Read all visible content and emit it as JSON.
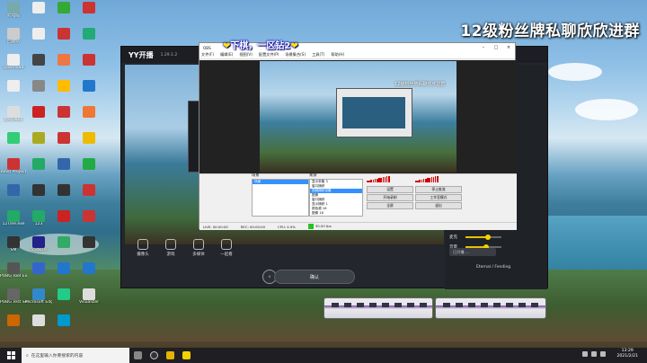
{
  "banner": {
    "text": "12级粉丝牌私聊欣欣进群"
  },
  "desktop": {
    "col1": [
      "此电脑",
      "回收站",
      "Download",
      "",
      "qyiqiweb",
      "",
      "Revit Project",
      "",
      "12Tree.exe",
      "SM",
      "PUBG Tool Experiment",
      "PUBG Test Server",
      "",
      "Microsoft Fortune",
      "",
      "飞"
    ],
    "col2": [
      "",
      "",
      "",
      "",
      "",
      "ESkin",
      "",
      "",
      "",
      "",
      "123",
      "554879",
      "",
      "Microsoft Edge",
      "",
      "Steam"
    ],
    "col3": [
      "",
      "",
      "",
      "",
      "",
      "",
      "",
      "",
      "",
      "",
      "",
      "",
      "",
      "VSCode",
      "QQ",
      "YY"
    ],
    "col4": [
      "",
      "",
      "",
      "",
      "",
      "",
      "",
      "",
      "",
      "",
      "",
      "",
      "",
      "",
      "",
      "Visualizer"
    ],
    "labels_visible": [
      "Download",
      "Revit Project",
      "12Tree.exe",
      "PUBG Tool Experiment",
      "PUBG Test Server",
      "123",
      "554879",
      "Microsoft Edge",
      "Microsoft Fortune",
      "Steam",
      "Visualizer",
      "Welcomeoly"
    ]
  },
  "yy": {
    "logo": "YY开播",
    "version": "1.29.1.2",
    "confirm_label": "确认",
    "tools": [
      "摄像头",
      "游戏",
      "多媒体",
      "一起看"
    ],
    "sliders": [
      {
        "label": "麦克",
        "level": 0.6
      },
      {
        "label": "音量",
        "level": 0.55
      }
    ],
    "channel": "Eternal / Fending",
    "status_text": "已开播 ..."
  },
  "obs": {
    "title": "OBS",
    "overlay": {
      "heart": "❤",
      "text": "下棋，一区钻2"
    },
    "menu": [
      "文件(F)",
      "编辑(E)",
      "视图(V)",
      "配置文件(P)",
      "场景集合(S)",
      "工具(T)",
      "帮助(H)"
    ],
    "live_text": "12级粉丝牌私聊欣欣进群",
    "scenes_label": "场景",
    "sources_label": "来源",
    "scenes": [
      "场景"
    ],
    "sources": [
      "显示采集 3",
      "窗口捕获",
      "视频捕获设备",
      "图像",
      "窗口捕获",
      "显示捕获 1",
      "颜色源 16",
      "图像 16"
    ],
    "buttons": [
      "设置",
      "停止推流",
      "开始录制",
      "工作室模式",
      "全屏",
      "退出"
    ],
    "status": [
      "LIVE: 00:00:00",
      "REC: 00:00:00",
      "CPU: 4.9%",
      "30.00 fps"
    ]
  },
  "taskbar": {
    "search_placeholder": "在这里输入你要搜索的内容",
    "time": "13:29",
    "date": "2021/2/21"
  },
  "colors": {
    "accent": "#3391ff",
    "obs_meter": "#d10000",
    "yy_slider": "#f3d200",
    "live_green": "#22c322"
  }
}
